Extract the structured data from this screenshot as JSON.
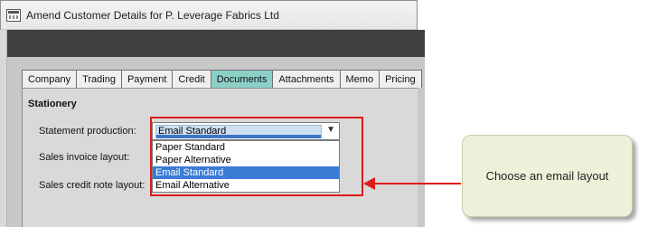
{
  "window": {
    "title": "Amend Customer Details for P. Leverage Fabrics Ltd"
  },
  "tabs": [
    {
      "label": "Company",
      "active": false
    },
    {
      "label": "Trading",
      "active": false
    },
    {
      "label": "Payment",
      "active": false
    },
    {
      "label": "Credit",
      "active": false
    },
    {
      "label": "Documents",
      "active": true
    },
    {
      "label": "Attachments",
      "active": false
    },
    {
      "label": "Memo",
      "active": false
    },
    {
      "label": "Pricing",
      "active": false
    }
  ],
  "stationery": {
    "section_title": "Stationery",
    "statement_label": "Statement production:",
    "sales_invoice_label": "Sales invoice layout:",
    "sales_credit_label": "Sales credit note layout:",
    "statement_value": "Email Standard",
    "options": [
      "Paper Standard",
      "Paper Alternative",
      "Email Standard",
      "Email Alternative"
    ],
    "selected_index": 2
  },
  "callout": {
    "text": "Choose an email layout"
  },
  "colors": {
    "active_tab": "#8ccfc7",
    "highlight": "#e01b1b",
    "selection": "#3a7bd5",
    "callout_bg": "#eef0d9"
  },
  "icons": {
    "app": "window-grid-icon",
    "dropdown": "chevron-down-icon"
  }
}
